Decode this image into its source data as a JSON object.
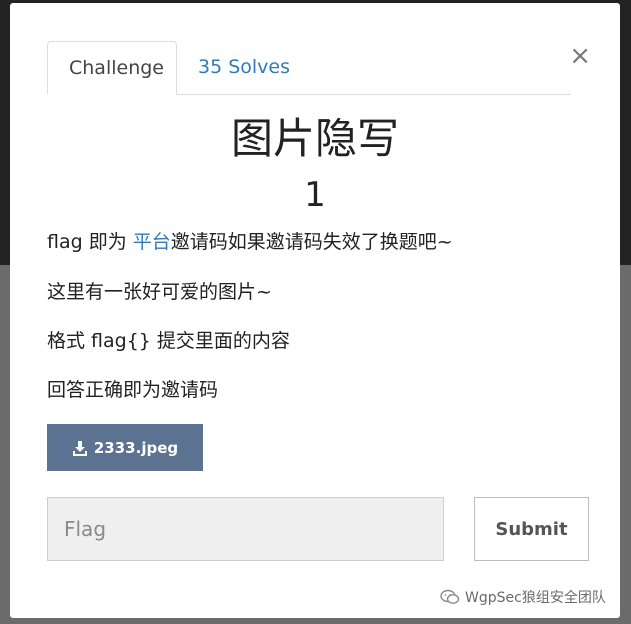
{
  "tabs": {
    "challenge_label": "Challenge",
    "solves_label": "35 Solves"
  },
  "close_symbol": "×",
  "challenge": {
    "name": "图片隐写",
    "value": "1",
    "description": {
      "line1_prefix": "flag 即为 ",
      "line1_link": "平台",
      "line1_suffix": "邀请码如果邀请码失效了换题吧~",
      "line2": "这里有一张好可爱的图片~",
      "line3": "格式 flag{} 提交里面的内容",
      "line4": "回答正确即为邀请码"
    },
    "file_label": "2333.jpeg",
    "file_icon": "download-icon"
  },
  "form": {
    "flag_placeholder": "Flag",
    "flag_value": "",
    "submit_label": "Submit"
  },
  "watermark": {
    "text": "WgpSec狼组安全团队",
    "icon": "wechat-icon"
  },
  "colors": {
    "link": "#337ab7",
    "download_button": "#5b7290"
  }
}
